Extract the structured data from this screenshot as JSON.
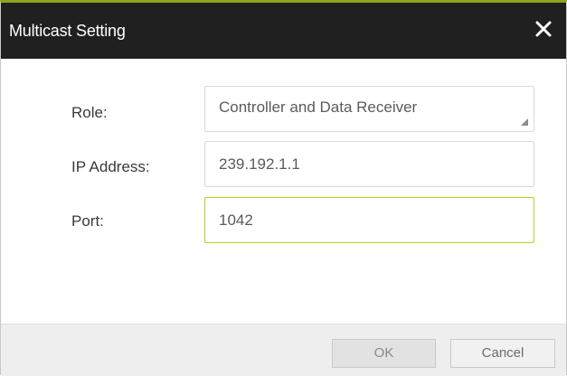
{
  "dialog": {
    "title": "Multicast Setting",
    "close_icon": "close-icon",
    "accent_color": "#b7cf2e"
  },
  "form": {
    "role": {
      "label": "Role:",
      "value": "Controller and Data Receiver"
    },
    "ip_address": {
      "label": "IP Address:",
      "value": "239.192.1.1"
    },
    "port": {
      "label": "Port:",
      "value": "1042"
    }
  },
  "footer": {
    "ok_label": "OK",
    "cancel_label": "Cancel"
  }
}
